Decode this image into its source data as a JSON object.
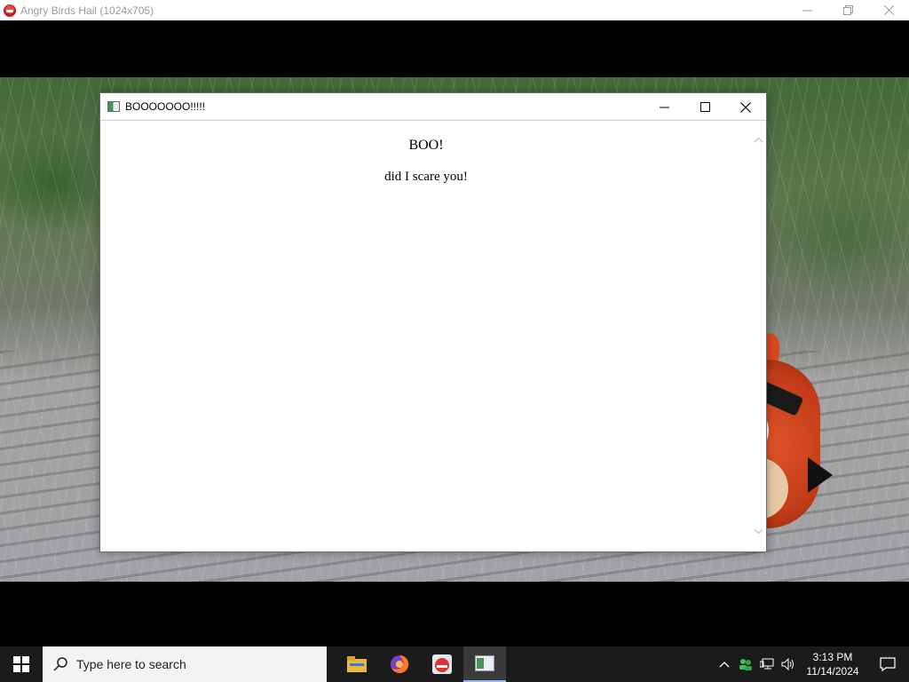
{
  "window": {
    "title": "Angry Birds Hail (1024x705)",
    "icon": "angry-bird-icon"
  },
  "popup": {
    "title": "BOOOOOOO!!!!!",
    "heading": "BOO!",
    "message": "did I scare you!"
  },
  "taskbar": {
    "search_placeholder": "Type here to search",
    "apps": [
      "file-explorer-icon",
      "firefox-icon",
      "angry-birds-icon",
      "popup-app-icon"
    ],
    "clock_time": "3:13 PM",
    "clock_date": "11/14/2024"
  },
  "colors": {
    "taskbar_bg": "#1b1b1b",
    "popup_bg": "#ffffff",
    "bird_red": "#c23c18"
  }
}
